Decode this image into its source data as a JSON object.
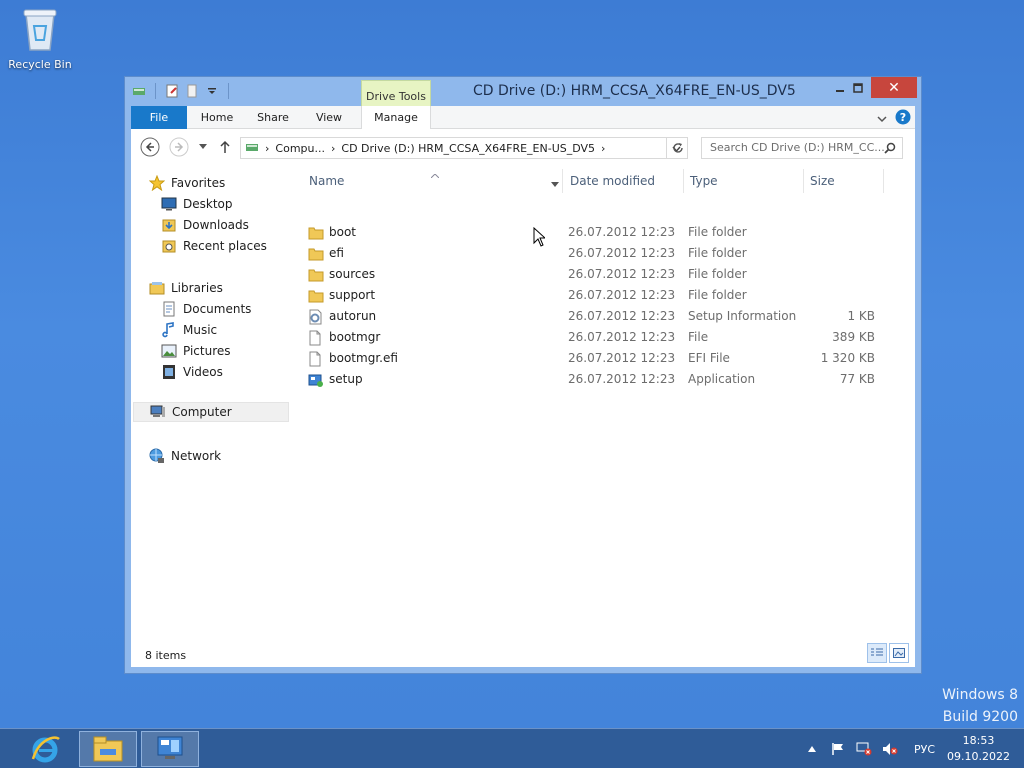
{
  "desktop": {
    "recycle_bin_label": "Recycle Bin",
    "watermark_line1": "Windows 8",
    "watermark_line2": "Build 9200"
  },
  "window": {
    "title": "CD Drive (D:) HRM_CCSA_X64FRE_EN-US_DV5",
    "context_tab": "Drive Tools",
    "close_symbol": "✕"
  },
  "ribbon": {
    "tabs": [
      "File",
      "Home",
      "Share",
      "View",
      "Manage"
    ]
  },
  "address": {
    "crumbs": [
      "Compu...",
      "CD Drive (D:) HRM_CCSA_X64FRE_EN-US_DV5"
    ],
    "search_placeholder": "Search CD Drive (D:) HRM_CC..."
  },
  "nav": {
    "favorites": "Favorites",
    "desktop": "Desktop",
    "downloads": "Downloads",
    "recent": "Recent places",
    "libraries": "Libraries",
    "documents": "Documents",
    "music": "Music",
    "pictures": "Pictures",
    "videos": "Videos",
    "computer": "Computer",
    "network": "Network"
  },
  "columns": {
    "name": "Name",
    "date": "Date modified",
    "type": "Type",
    "size": "Size"
  },
  "files": [
    {
      "name": "boot",
      "date": "26.07.2012 12:23",
      "type": "File folder",
      "size": "",
      "icon": "folder"
    },
    {
      "name": "efi",
      "date": "26.07.2012 12:23",
      "type": "File folder",
      "size": "",
      "icon": "folder"
    },
    {
      "name": "sources",
      "date": "26.07.2012 12:23",
      "type": "File folder",
      "size": "",
      "icon": "folder"
    },
    {
      "name": "support",
      "date": "26.07.2012 12:23",
      "type": "File folder",
      "size": "",
      "icon": "folder"
    },
    {
      "name": "autorun",
      "date": "26.07.2012 12:23",
      "type": "Setup Information",
      "size": "1 KB",
      "icon": "setup-info"
    },
    {
      "name": "bootmgr",
      "date": "26.07.2012 12:23",
      "type": "File",
      "size": "389 KB",
      "icon": "file"
    },
    {
      "name": "bootmgr.efi",
      "date": "26.07.2012 12:23",
      "type": "EFI File",
      "size": "1 320 KB",
      "icon": "file"
    },
    {
      "name": "setup",
      "date": "26.07.2012 12:23",
      "type": "Application",
      "size": "77 KB",
      "icon": "application"
    }
  ],
  "status": {
    "item_count": "8 items"
  },
  "taskbar": {
    "language": "РУС",
    "time": "18:53",
    "date": "09.10.2022"
  }
}
